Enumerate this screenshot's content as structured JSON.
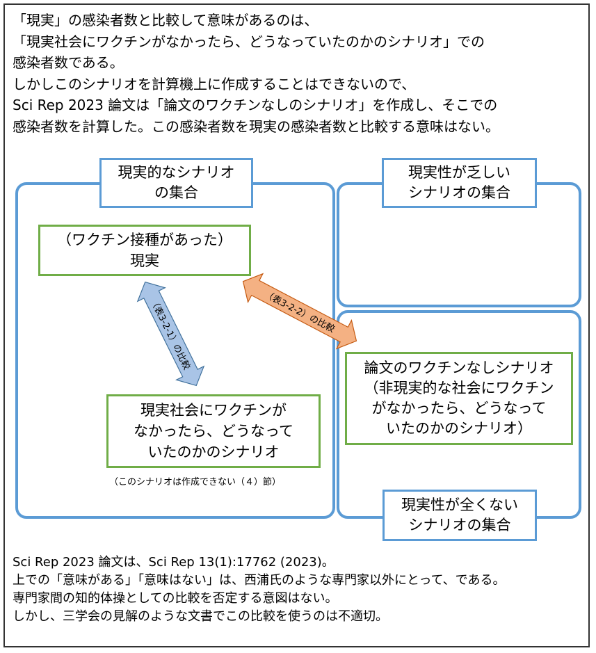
{
  "intro": {
    "lines": [
      "「現実」の感染者数と比較して意味があるのは、",
      "「現実社会にワクチンがなかったら、どうなっていたのかのシナリオ」での",
      "感染者数である。",
      "しかしこのシナリオを計算機上に作成することはできないので、",
      "Sci Rep 2023 論文は「論文のワクチンなしのシナリオ」を作成し、そこでの",
      "感染者数を計算した。この感染者数を現実の感染者数と比較する意味はない。"
    ]
  },
  "regions": {
    "realistic": {
      "label_line1": "現実的なシナリオ",
      "label_line2": "の集合"
    },
    "unlikely": {
      "label_line1": "現実性が乏しい",
      "label_line2": "シナリオの集合"
    },
    "unrealistic": {
      "label_line1": "現実性が全くない",
      "label_line2": "シナリオの集合"
    }
  },
  "boxes": {
    "reality": {
      "line1": "（ワクチン接種があった）",
      "line2": "現実"
    },
    "counterfactual": {
      "line1": "現実社会にワクチンが",
      "line2": "なかったら、どうなって",
      "line3": "いたのかのシナリオ"
    },
    "counterfactual_note": "（このシナリオは作成できない（４）節）",
    "paper_scenario": {
      "line1": "論文のワクチンなしシナリオ",
      "line2": "（非現実的な社会にワクチン",
      "line3": "がなかったら、どうなって",
      "line4": "いたのかのシナリオ）"
    }
  },
  "arrows": {
    "comparison_3_2_1": {
      "label": "（表3-2-1）の比較",
      "color": "#a9c4e6"
    },
    "comparison_3_2_2": {
      "label": "（表3-2-2）の比較",
      "color": "#f4b183"
    }
  },
  "footer": {
    "lines": [
      "Sci Rep 2023 論文は、Sci Rep 13(1):17762 (2023)。",
      "上での「意味がある」「意味はない」は、西浦氏のような専門家以外にとって、である。",
      "専門家間の知的体操としての比較を否定する意図はない。",
      "しかし、三学会の見解のような文書でこの比較を使うのは不適切。"
    ]
  },
  "colors": {
    "region_border": "#5b9bd5",
    "scenario_border": "#70ad47",
    "frame_border": "#333333"
  }
}
